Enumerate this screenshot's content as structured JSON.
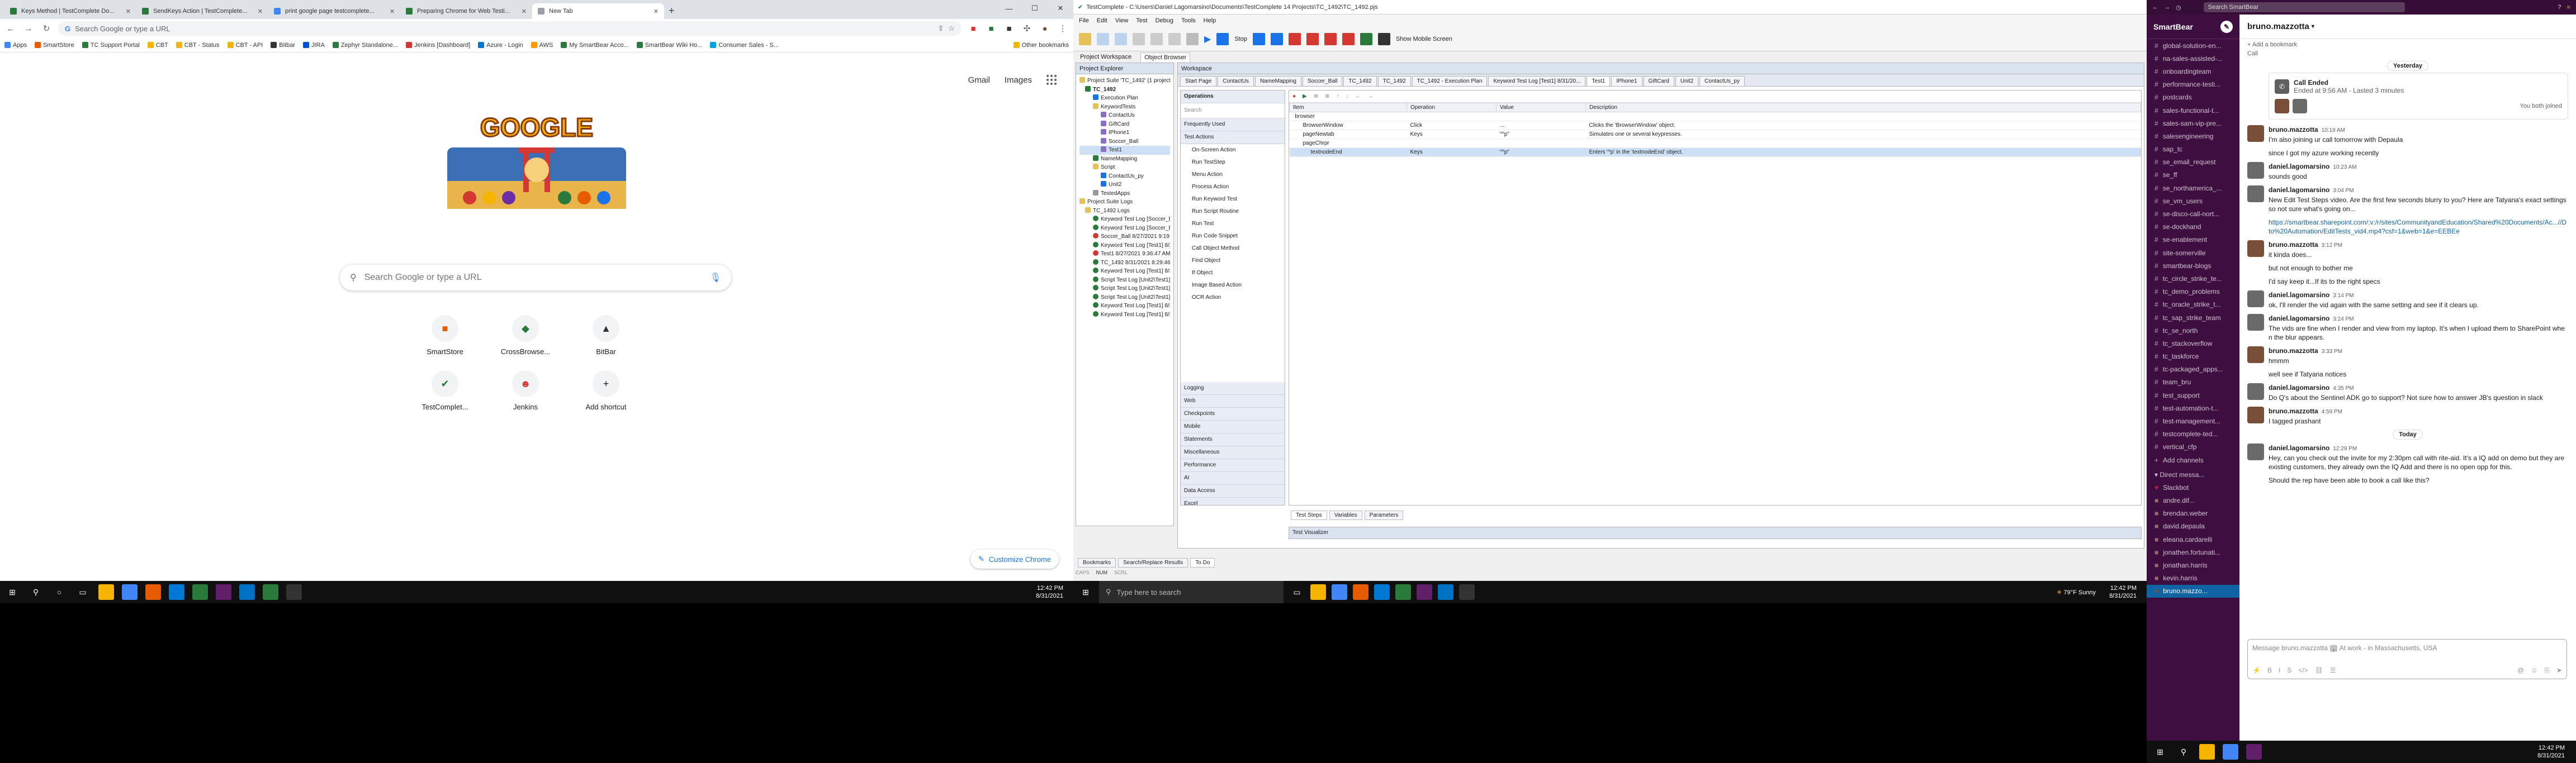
{
  "chrome": {
    "tabs": [
      {
        "title": "Keys Method | TestComplete Do...",
        "color": "#2a7a3c"
      },
      {
        "title": "SendKeys Action | TestComplete...",
        "color": "#2a7a3c"
      },
      {
        "title": "print google page testcomplete...",
        "color": "#4285f4"
      },
      {
        "title": "Preparing Chrome for Web Testi...",
        "color": "#2a7a3c"
      },
      {
        "title": "New Tab",
        "color": "#9aa0a6"
      }
    ],
    "omnibox_placeholder": "Search Google or type a URL",
    "bookmarks": [
      {
        "label": "Apps",
        "color": "#4285f4"
      },
      {
        "label": "SmartStore",
        "color": "#e65c00"
      },
      {
        "label": "TC Support Portal",
        "color": "#2a7a3c"
      },
      {
        "label": "CBT",
        "color": "#f4b400"
      },
      {
        "label": "CBT - Status",
        "color": "#f4b400"
      },
      {
        "label": "CBT - API",
        "color": "#f4b400"
      },
      {
        "label": "Bitbar",
        "color": "#333"
      },
      {
        "label": "JIRA",
        "color": "#0052cc"
      },
      {
        "label": "Zephyr Standalone...",
        "color": "#2a7a3c"
      },
      {
        "label": "Jenkins [Dashboard]",
        "color": "#d33833"
      },
      {
        "label": "Azure - Login",
        "color": "#0078d4"
      },
      {
        "label": "AWS",
        "color": "#ff9900"
      },
      {
        "label": "My SmartBear Acco...",
        "color": "#2a7a3c"
      },
      {
        "label": "SmartBear Wiki Ho...",
        "color": "#2a7a3c"
      },
      {
        "label": "Consumer Sales - S...",
        "color": "#00a1e0"
      }
    ],
    "other_bookmarks": "Other bookmarks",
    "ntp": {
      "gmail": "Gmail",
      "images": "Images",
      "search_placeholder": "Search Google or type a URL",
      "shortcuts": [
        {
          "label": "SmartStore",
          "icon": "smartstore-icon",
          "color": "#e65c00"
        },
        {
          "label": "CrossBrowse...",
          "icon": "crossbrowser-icon",
          "color": "#2a7a3c"
        },
        {
          "label": "BitBar",
          "icon": "bitbar-icon",
          "color": "#333"
        },
        {
          "label": "TestComplet...",
          "icon": "testcomplete-icon",
          "color": "#2a7a3c"
        },
        {
          "label": "Jenkins",
          "icon": "jenkins-icon",
          "color": "#d33833"
        },
        {
          "label": "Add shortcut",
          "icon": "plus-icon",
          "color": "#202124"
        }
      ],
      "customize": "Customize Chrome"
    },
    "clock": {
      "time": "12:42 PM",
      "date": "8/31/2021"
    }
  },
  "testcomplete": {
    "title": "TestComplete - C:\\Users\\Daniel.Lagomarsino\\Documents\\TestComplete 14 Projects\\TC_1492\\TC_1492.pjs",
    "menu": [
      "File",
      "Edit",
      "View",
      "Test",
      "Debug",
      "Tools",
      "Help"
    ],
    "stop_label": "Stop",
    "show_mobile": "Show Mobile Screen",
    "sub_tabs": [
      "Project Workspace",
      "Object Browser"
    ],
    "explorer_title": "Project Explorer",
    "tree": [
      "Project Suite 'TC_1492' (1 project)",
      "TC_1492",
      "Execution Plan",
      "KeywordTests",
      "ContactUs",
      "GiftCard",
      "IPhone1",
      "Soccer_Ball",
      "Test1",
      "NameMapping",
      "Script",
      "ContactUs_py",
      "Unit2",
      "TestedApps",
      "Project Suite Logs",
      "TC_1492 Logs",
      "Keyword Test Log [Soccer_Ball] 8/27/2021 9:09:27 AM",
      "Keyword Test Log [Soccer_Ball] 8/27/2021 9:12:31 AM",
      "Soccer_Ball 8/27/2021 9:19:57 AM",
      "Keyword Test Log [Test1] 8/27/2021 9:33:53 AM",
      "Test1 8/27/2021 9:36:47 AM",
      "TC_1492 8/31/2021 8:29:46 AM",
      "Keyword Test Log [Test1] 8/31/2021 12:35:50 PM",
      "Script Test Log [Unit2\\Test1] 8/31/2021 12:37:36 PM",
      "Script Test Log [Unit2\\Test1] 8/31/2021 12:38:05 PM",
      "Script Test Log [Unit2\\Test1] 8/31/2021 12:38:23 PM",
      "Keyword Test Log [Test1] 8/31/2021 12:39:31 PM",
      "Keyword Test Log [Test1] 8/31/2021 12:41:49 PM"
    ],
    "bottom_tabs": [
      "Bookmarks",
      "Search/Replace Results",
      "To Do"
    ],
    "workspace_title": "Workspace",
    "ws_tabs": [
      "Start Page",
      "ContactUs",
      "NameMapping",
      "Soccer_Ball",
      "TC_1492",
      "TC_1492",
      "TC_1492 - Execution Plan",
      "Keyword Test Log [Test1] 8/31/20...",
      "Test1",
      "IPhone1",
      "GiftCard",
      "Unit2",
      "ContactUs_py"
    ],
    "ops_title": "Operations",
    "ops_search": "Search",
    "ops_groups": [
      "Frequently Used",
      "Test Actions"
    ],
    "ops_items": [
      "On-Screen Action",
      "Run TestStep",
      "Menu Action",
      "Process Action",
      "Run Keyword Test",
      "Run Script Routine",
      "Run Test",
      "Run Code Snippet",
      "Call Object Method",
      "Find Object",
      "If Object",
      "Image Based Action",
      "OCR Action"
    ],
    "ops_cats": [
      "Logging",
      "Web",
      "Checkpoints",
      "Mobile",
      "Statements",
      "Miscellaneous",
      "Performance",
      "AI",
      "Data Access",
      "Excel"
    ],
    "grid_headers": [
      "Item",
      "Operation",
      "Value",
      "Description"
    ],
    "grid_rows": [
      {
        "item": "browser",
        "op": "",
        "val": "",
        "desc": ""
      },
      {
        "item": "BrowserWindow",
        "op": "Click",
        "val": "...",
        "desc": "Clicks the 'BrowserWindow' object."
      },
      {
        "item": "pageNewtab",
        "op": "Keys",
        "val": "\"^p\"",
        "desc": "Simulates one or several keypresses."
      },
      {
        "item": "pageChrpr",
        "op": "",
        "val": "",
        "desc": ""
      },
      {
        "item": "textnodeEnd",
        "op": "Keys",
        "val": "\"^p\"",
        "desc": "Enters '^p' in the 'textnodeEnd' object."
      }
    ],
    "grid_bottom_tabs": [
      "Test Steps",
      "Variables",
      "Parameters"
    ],
    "visualizer": "Test Visualizer",
    "status": [
      "CAPS",
      "NUM",
      "SCRL"
    ],
    "taskbar_search": "Type here to search",
    "weather": "79°F Sunny",
    "clock": {
      "time": "12:42 PM",
      "date": "8/31/2021"
    }
  },
  "slack": {
    "search": "Search SmartBear",
    "workspace": "SmartBear",
    "channels": [
      "global-solution-en...",
      "na-sales-assisted-...",
      "onboardingteam",
      "performance-testi...",
      "postcards",
      "sales-functional-t...",
      "sales-sam-vip-pre...",
      "salesengineering",
      "sap_tc",
      "se_email_request",
      "se_ff",
      "se_northamerica_...",
      "se_vm_users",
      "se-disco-call-nort...",
      "se-dockhand",
      "se-enablement",
      "site-somerville",
      "smartbear-blogs",
      "tc_circle_strike_te...",
      "tc_demo_problems",
      "tc_oracle_strike_t...",
      "tc_sap_strike_team",
      "tc_se_north",
      "tc_stackoverflow",
      "tc_taskforce",
      "tc-packaged_apps...",
      "team_bru",
      "test_support",
      "test-automation-t...",
      "test-management...",
      "testcomplete-ted...",
      "vertical_cfp"
    ],
    "add_channels": "Add channels",
    "dm_header": "Direct messa...",
    "dms": [
      "Slackbot",
      "andre.dif...",
      "brendan.weber",
      "david.depaula",
      "eleana.cardarelli",
      "jonathen.fortunati...",
      "jonathan.harris",
      "kevin.harris"
    ],
    "self_dm": "bruno.mazzo...",
    "channel_title": "bruno.mazzotta",
    "add_bookmark": "Add a bookmark",
    "call_label": "Call",
    "yesterday": "Yesterday",
    "today": "Today",
    "call_ended": "Call Ended",
    "call_time": "Ended at 9:56 AM - Lasted 3 minutes",
    "you_joined": "You both joined",
    "messages": [
      {
        "name": "bruno.mazzotta",
        "time": "10:19 AM",
        "text": "I'm also joining ur call tomorrow with Depaula",
        "color": "#7a4f3a"
      },
      {
        "name": "",
        "time": "",
        "text": "since I got my azure working recently",
        "color": ""
      },
      {
        "name": "daniel.lagomarsino",
        "time": "10:23 AM",
        "text": "sounds good",
        "color": "#6a6a6a"
      },
      {
        "name": "daniel.lagomarsino",
        "time": "3:04 PM",
        "text": "New Edit Test Steps video. Are the first few seconds blurry to you? Here are Tatyana's exact settings so not sure what's going on...",
        "color": "#6a6a6a"
      },
      {
        "name": "",
        "time": "",
        "text": "https://smartbear.sharepoint.com/:v:/r/sites/CommunityandEducation/Shared%20Documents/Ac...//Dto%20Automation/EditTests_vid4.mp4?csf=1&web=1&e=EEBEe",
        "color": "",
        "link": true
      },
      {
        "name": "bruno.mazzotta",
        "time": "3:12 PM",
        "text": "it kinda does...",
        "color": "#7a4f3a"
      },
      {
        "name": "",
        "time": "",
        "text": "but not enough to bother me",
        "color": ""
      },
      {
        "name": "",
        "time": "",
        "text": "I'd say keep it...If its to the right specs",
        "color": ""
      },
      {
        "name": "daniel.lagomarsino",
        "time": "3:14 PM",
        "text": "ok, I'll render the vid again with the same setting and see if it clears up.",
        "color": "#6a6a6a"
      },
      {
        "name": "daniel.lagomarsino",
        "time": "3:24 PM",
        "text": "The vids are fine when I render and view from my laptop. It's when I upload them to SharePoint when the blur appears.",
        "color": "#6a6a6a"
      },
      {
        "name": "bruno.mazzotta",
        "time": "3:33 PM",
        "text": "hmmm",
        "color": "#7a4f3a"
      },
      {
        "name": "",
        "time": "",
        "text": "well see if Tatyana notices",
        "color": ""
      },
      {
        "name": "daniel.lagomarsino",
        "time": "4:35 PM",
        "text": "Do Q's about the Sentinel ADK go to support? Not sure how to answer JB's question in slack",
        "color": "#6a6a6a"
      },
      {
        "name": "bruno.mazzotta",
        "time": "4:59 PM",
        "text": "I tagged prashant",
        "color": "#7a4f3a"
      }
    ],
    "today_messages": [
      {
        "name": "daniel.lagomarsino",
        "time": "12:29 PM",
        "text": "Hey, can you check out the invite for my 2:30pm call with rite-aid. It's a IQ add on demo but they are existing customers, they already own the IQ Add and there is no open opp for this.",
        "color": "#6a6a6a"
      },
      {
        "name": "",
        "time": "",
        "text": "Should the rep have been able to book a call like this?",
        "color": ""
      }
    ],
    "compose_placeholder": "Message bruno.mazzotta",
    "status_note": "At work - in Massachusetts, USA",
    "clock": {
      "time": "12:42 PM",
      "date": "8/31/2021"
    }
  }
}
